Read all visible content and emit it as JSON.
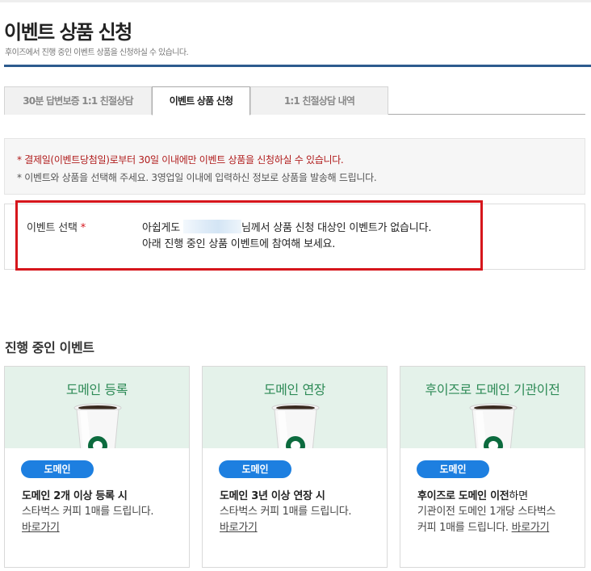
{
  "page": {
    "title": "이벤트 상품 신청",
    "subtitle": "후이즈에서 진행 중인 이벤트 상품을 신청하실 수 있습니다."
  },
  "tabs": [
    {
      "label": "30분 답변보증 1:1 친절상담",
      "active": false
    },
    {
      "label": "이벤트 상품 신청",
      "active": true
    },
    {
      "label": "1:1 친절상담 내역",
      "active": false
    }
  ],
  "notice": {
    "line1": "* 결제일(이벤트당첨일)로부터 30일 이내에만 이벤트 상품을 신청하실 수 있습니다.",
    "line2": "* 이벤트와 상품을 선택해 주세요. 3영업일 이내에 입력하신 정보로 상품을 발송해 드립니다."
  },
  "event_select": {
    "label": "이벤트 선택",
    "required_mark": "*",
    "msg_prefix": "아쉽게도",
    "msg_suffix": "님께서 상품 신청 대상인 이벤트가 없습니다.",
    "msg_line2": "아래 진행 중인 상품 이벤트에 참여해 보세요."
  },
  "ongoing": {
    "title": "진행 중인 이벤트",
    "cards": [
      {
        "title": "도메인 등록",
        "badge": "도메인",
        "heading": "도메인 2개 이상 등록 시",
        "desc": "스타벅스 커피 1매를 드립니다.",
        "link": "바로가기"
      },
      {
        "title": "도메인 연장",
        "badge": "도메인",
        "heading": "도메인 3년 이상 연장 시",
        "desc": "스타벅스 커피 1매를 드립니다.",
        "link": "바로가기"
      },
      {
        "title": "후이즈로 도메인 기관이전",
        "badge": "도메인",
        "heading_bold": "후이즈로 도메인 이전",
        "heading_normal": "하면",
        "desc_line1": "기관이전 도메인 1개당 스타벅스",
        "desc_line2": "커피 1매를 드립니다.",
        "link": "바로가기"
      }
    ]
  },
  "colors": {
    "title_rule": "#2d5b8e",
    "highlight_frame": "#d6161c",
    "badge": "#1d7fe0",
    "card_title": "#2e8b57",
    "card_top_bg": "#e4f2ea"
  }
}
